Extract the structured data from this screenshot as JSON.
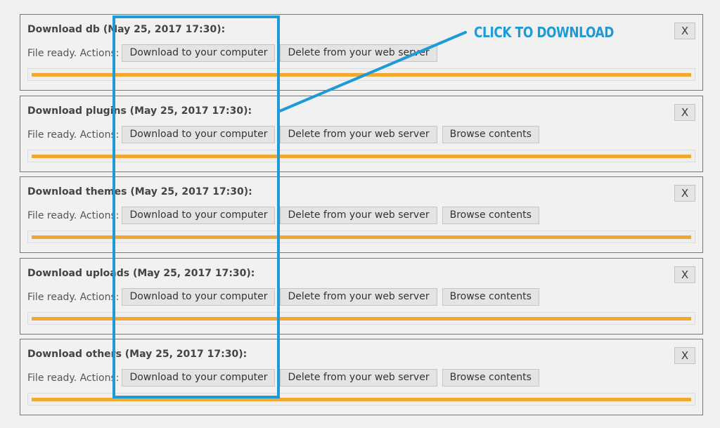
{
  "common": {
    "status_label": "File ready. Actions:",
    "download_label": "Download to your computer",
    "delete_label": "Delete from your web server",
    "browse_label": "Browse contents",
    "close_label": "X"
  },
  "panels": [
    {
      "title": "Download db (May 25, 2017 17:30):",
      "has_browse": false,
      "progress_percent": 100
    },
    {
      "title": "Download plugins (May 25, 2017 17:30):",
      "has_browse": true,
      "progress_percent": 100
    },
    {
      "title": "Download themes (May 25, 2017 17:30):",
      "has_browse": true,
      "progress_percent": 100
    },
    {
      "title": "Download uploads (May 25, 2017 17:30):",
      "has_browse": true,
      "progress_percent": 100
    },
    {
      "title": "Download others (May 25, 2017 17:30):",
      "has_browse": true,
      "progress_percent": 100
    }
  ],
  "annotation": {
    "callout_text": "CLICK TO DOWNLOAD",
    "color": "#1e9bd7"
  },
  "colors": {
    "progress_fill": "#f0a830"
  }
}
